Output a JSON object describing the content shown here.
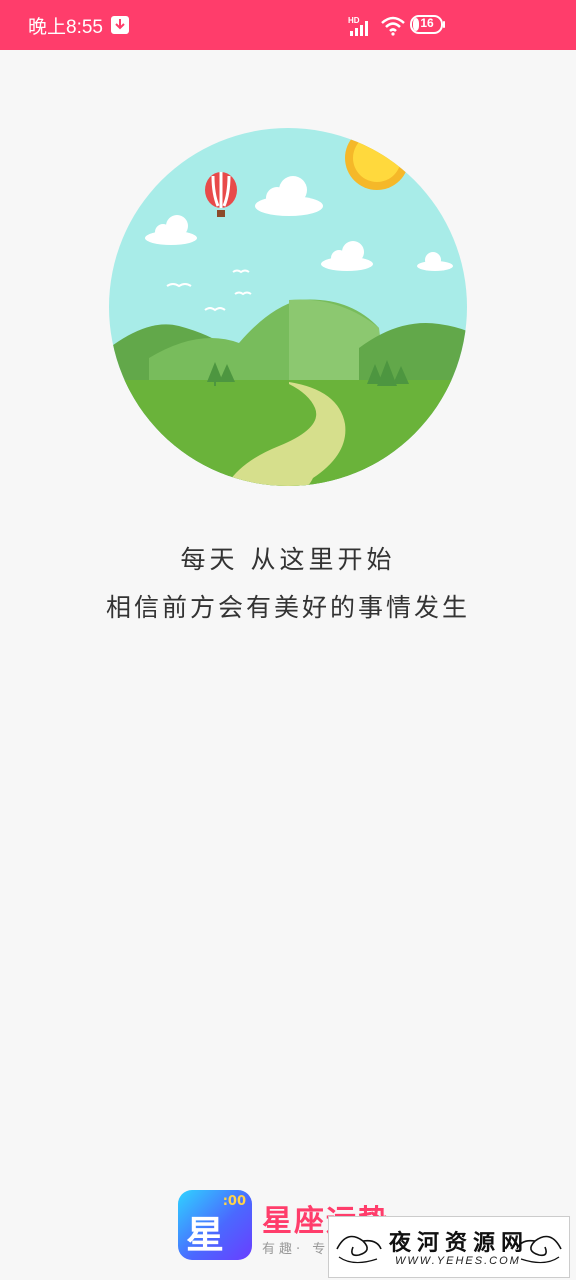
{
  "status_bar": {
    "time": "晚上8:55",
    "network_label": "HD",
    "battery_level": "16",
    "icons": [
      "download-notification-icon",
      "signal-icon",
      "wifi-icon",
      "battery-icon"
    ],
    "background_color": "#ff3d6b"
  },
  "splash": {
    "illustration": "landscape-illustration",
    "line1": "每天  从这里开始",
    "line2": "相信前方会有美好的事情发生"
  },
  "footer": {
    "logo_text": "星座",
    "logo_badge": ":00",
    "app_name": "星座运势",
    "tagline": "有趣· 专 · 好玩"
  },
  "watermark": {
    "title": "夜河资源网",
    "url": "WWW.YEHES.COM"
  }
}
